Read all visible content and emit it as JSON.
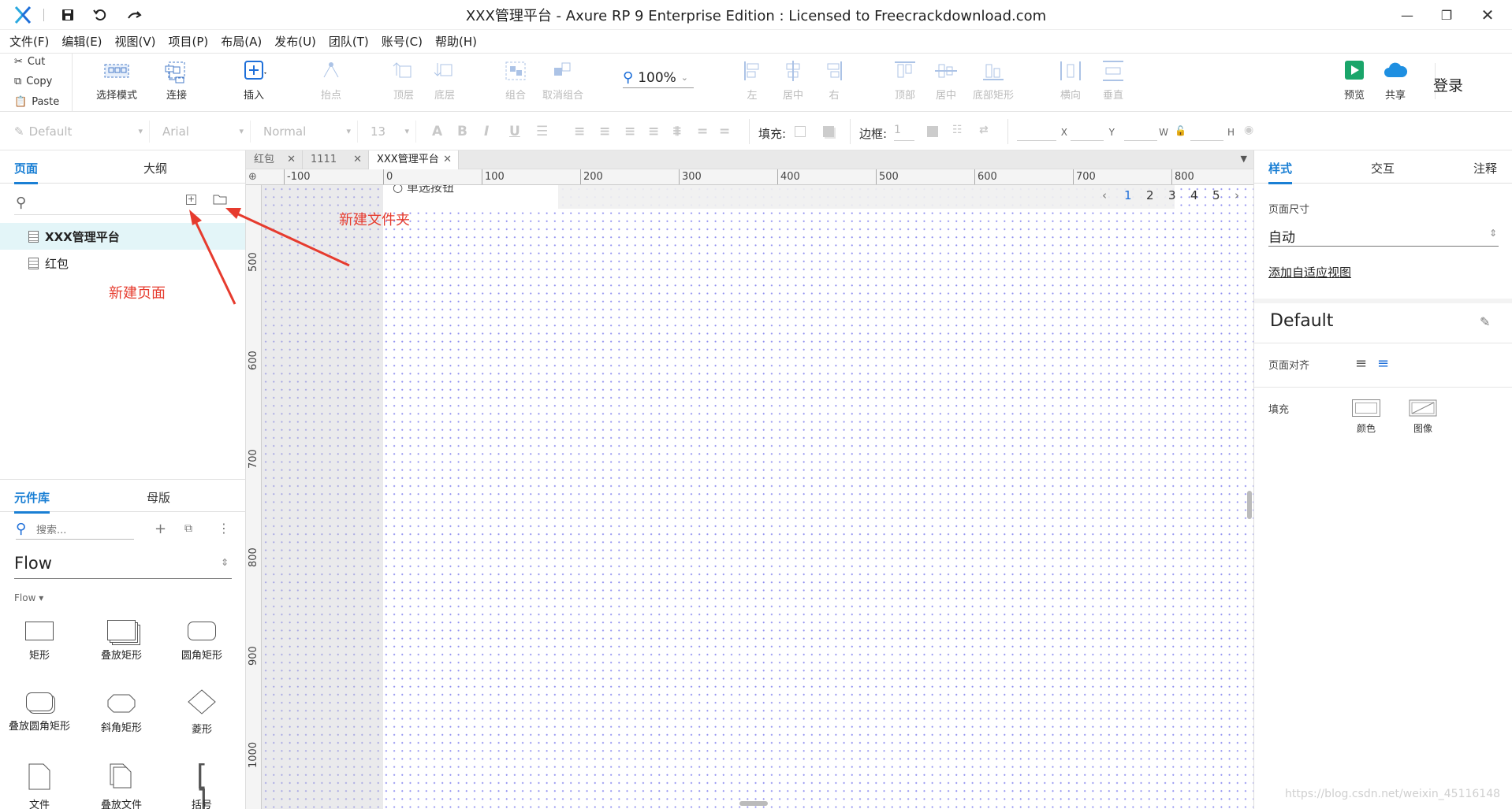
{
  "window": {
    "title": "XXX管理平台 - Axure RP 9 Enterprise Edition : Licensed to Freecrackdownload.com",
    "controls": [
      "minimize-icon",
      "restore-icon",
      "close-icon"
    ]
  },
  "quick_access": [
    "save-icon",
    "undo-icon",
    "redo-icon"
  ],
  "menu": [
    "文件(F)",
    "编辑(E)",
    "视图(V)",
    "项目(P)",
    "布局(A)",
    "发布(U)",
    "团队(T)",
    "账号(C)",
    "帮助(H)"
  ],
  "clipboard": {
    "cut": "Cut",
    "copy": "Copy",
    "paste": "Paste"
  },
  "toolbar": {
    "select_mode": "选择模式",
    "connect": "连接",
    "insert": "插入",
    "point": "抬点",
    "top_layer": "顶层",
    "bottom_layer": "底层",
    "group": "组合",
    "ungroup": "取消组合",
    "zoom": "100%",
    "align_left": "左",
    "align_center": "居中",
    "align_right": "右",
    "align_top": "顶部",
    "align_middle": "居中",
    "align_bottom": "底部矩形",
    "dist_h": "横向",
    "dist_v": "垂直",
    "preview": "预览",
    "share": "共享",
    "login": "登录",
    "accent_preview": "#1aa56a",
    "accent_share": "#1e8fe1"
  },
  "format": {
    "style": "Default",
    "font": "Arial",
    "weight": "Normal",
    "size": "13",
    "fill_label": "填充:",
    "border_label": "边框:",
    "border_value": "1",
    "x_label": "X",
    "y_label": "Y",
    "w_label": "W",
    "h_label": "H"
  },
  "pages_panel": {
    "tabs": [
      "页面",
      "大纲"
    ],
    "pages": [
      "XXX管理平台",
      "红包"
    ]
  },
  "library_panel": {
    "tabs": [
      "元件库",
      "母版"
    ],
    "search_placeholder": "搜索...",
    "library": "Flow",
    "section": "Flow ▾",
    "widgets": [
      "矩形",
      "叠放矩形",
      "圆角矩形",
      "叠放圆角矩形",
      "斜角矩形",
      "菱形",
      "文件",
      "叠放文件",
      "括号"
    ]
  },
  "doc_tabs": [
    "红包",
    "1111",
    "XXX管理平台"
  ],
  "ruler_h": [
    "-100",
    "0",
    "100",
    "200",
    "300",
    "400",
    "500",
    "600",
    "700",
    "800"
  ],
  "ruler_v": [
    "500",
    "600",
    "700",
    "800",
    "900",
    "1000"
  ],
  "canvas": {
    "partial_widget_text": "单选按钮",
    "pager": [
      "1",
      "2",
      "3",
      "4",
      "5"
    ],
    "pager_active": "1"
  },
  "right_panel": {
    "tabs": [
      "样式",
      "交互",
      "注释"
    ],
    "page_size_label": "页面尺寸",
    "page_size_value": "自动",
    "adaptive_link": "添加自适应视图",
    "style_name": "Default",
    "align_label": "页面对齐",
    "fill_label": "填充",
    "fill_color": "颜色",
    "fill_image": "图像"
  },
  "annotations": {
    "new_folder": "新建文件夹",
    "new_page": "新建页面",
    "color": "#e63b2e"
  },
  "watermark": "https://blog.csdn.net/weixin_45116148"
}
